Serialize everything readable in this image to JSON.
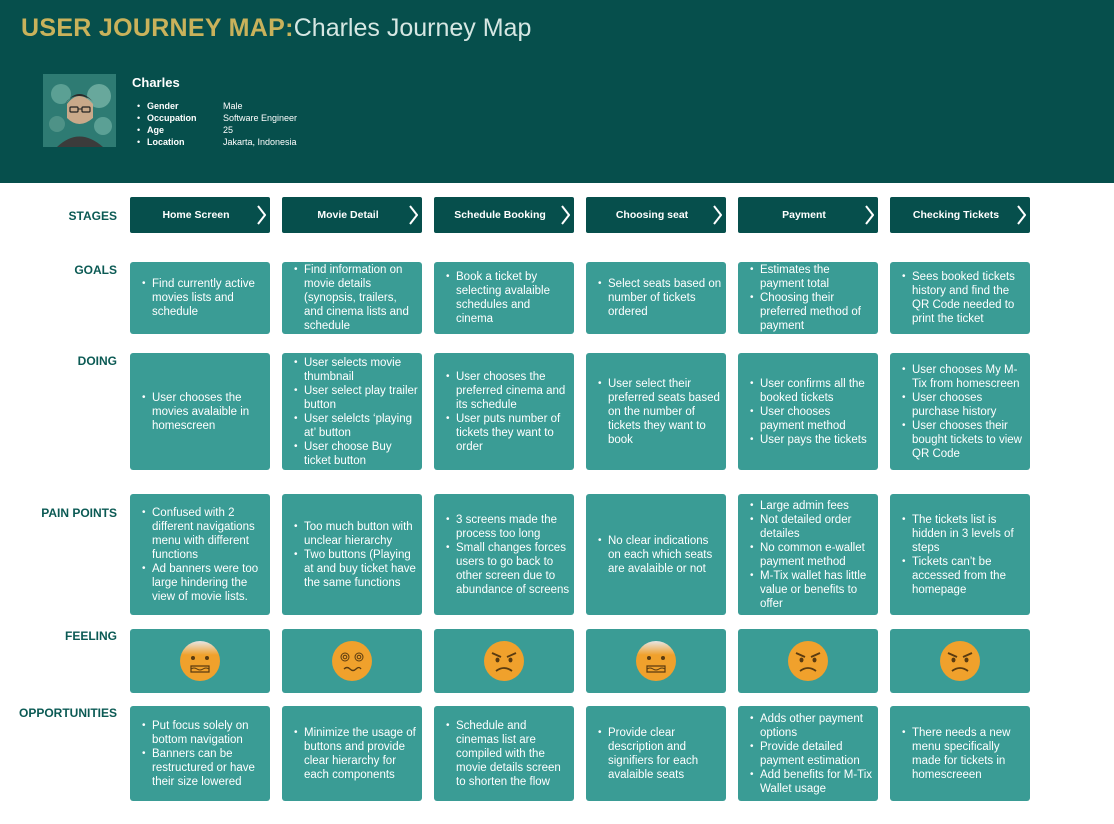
{
  "header": {
    "title_main": "USER JOURNEY MAP:",
    "title_sub": "Charles Journey Map"
  },
  "persona": {
    "name": "Charles",
    "attributes": [
      {
        "label": "Gender",
        "value": "Male"
      },
      {
        "label": "Occupation",
        "value": "Software Engineer"
      },
      {
        "label": "Age",
        "value": "25"
      },
      {
        "label": "Location",
        "value": "Jakarta, Indonesia"
      }
    ]
  },
  "row_labels": {
    "stages": "STAGES",
    "goals": "GOALS",
    "doing": "DOING",
    "pain_points": "PAIN POINTS",
    "feeling": "FEELING",
    "opportunities": "OPPORTUNITIES"
  },
  "stages": [
    "Home Screen",
    "Movie Detail",
    "Schedule Booking",
    "Choosing seat",
    "Payment",
    "Checking Tickets"
  ],
  "goals": [
    [
      "Find currently active movies lists and schedule"
    ],
    [
      "Find information on movie details (synopsis, trailers, and cinema lists and schedule"
    ],
    [
      "Book a ticket by selecting avalaible schedules and cinema"
    ],
    [
      "Select seats based on number of tickets ordered"
    ],
    [
      "Estimates the payment total",
      "Choosing their preferred method of payment"
    ],
    [
      "Sees booked tickets history and find the QR Code needed to print the ticket"
    ]
  ],
  "doing": [
    [
      "User chooses the movies avalaible in homescreen"
    ],
    [
      "User selects movie thumbnail",
      "User select play trailer button",
      "User selelcts ‘playing at’ button",
      "User choose Buy ticket button"
    ],
    [
      "User chooses the preferred cinema and its schedule",
      "User puts number of tickets they want to order"
    ],
    [
      "User select their preferred seats based on the number of tickets they want to book"
    ],
    [
      "User confirms all the booked tickets",
      "User chooses payment method",
      "User pays the tickets"
    ],
    [
      "User chooses My M-Tix from homescreen",
      "User chooses purchase history",
      "User chooses their bought tickets to view QR Code"
    ]
  ],
  "pain_points": [
    [
      "Confused with 2 different navigations menu with different functions",
      "Ad banners were too large hindering the view of movie lists."
    ],
    [
      "Too much button with unclear hierarchy",
      "Two buttons (Playing at and buy ticket have the same functions"
    ],
    [
      "3 screens made the process too long",
      "Small changes forces users to go back to other screen due to abundance of screens"
    ],
    [
      "No clear indications on each which seats are avalaible or not"
    ],
    [
      "Large admin fees",
      "Not detailed order detailes",
      "No common e-wallet payment method",
      "M-Tix wallet has little value or benefits to offer"
    ],
    [
      "The tickets list is hidden in 3 levels of steps",
      "Tickets can’t be accessed from the homepage"
    ]
  ],
  "feelings": [
    "grimacing-face-icon",
    "dizzy-face-icon",
    "angry-face-icon",
    "grimacing-face-icon",
    "angry-face-icon",
    "angry-face-icon"
  ],
  "opportunities": [
    [
      "Put focus solely on bottom navigation",
      "Banners can be restructured or have their size lowered"
    ],
    [
      "Minimize the usage of buttons and provide clear hierarchy for each components"
    ],
    [
      "Schedule and cinemas list are compiled with the movie details screen to shorten the flow"
    ],
    [
      "Provide clear description and signifiers for each avalaible seats"
    ],
    [
      "Adds other payment options",
      "Provide detailed payment estimation",
      "Add benefits for M-Tix Wallet usage"
    ],
    [
      "There needs a new menu specifically made for tickets in homescreeen"
    ]
  ],
  "colors": {
    "header_bg": "#064f4c",
    "card_bg": "#3a9c95",
    "title_accent": "#c9b25b",
    "label_text": "#0b5a54",
    "emoji_face": "#f0a12c"
  }
}
